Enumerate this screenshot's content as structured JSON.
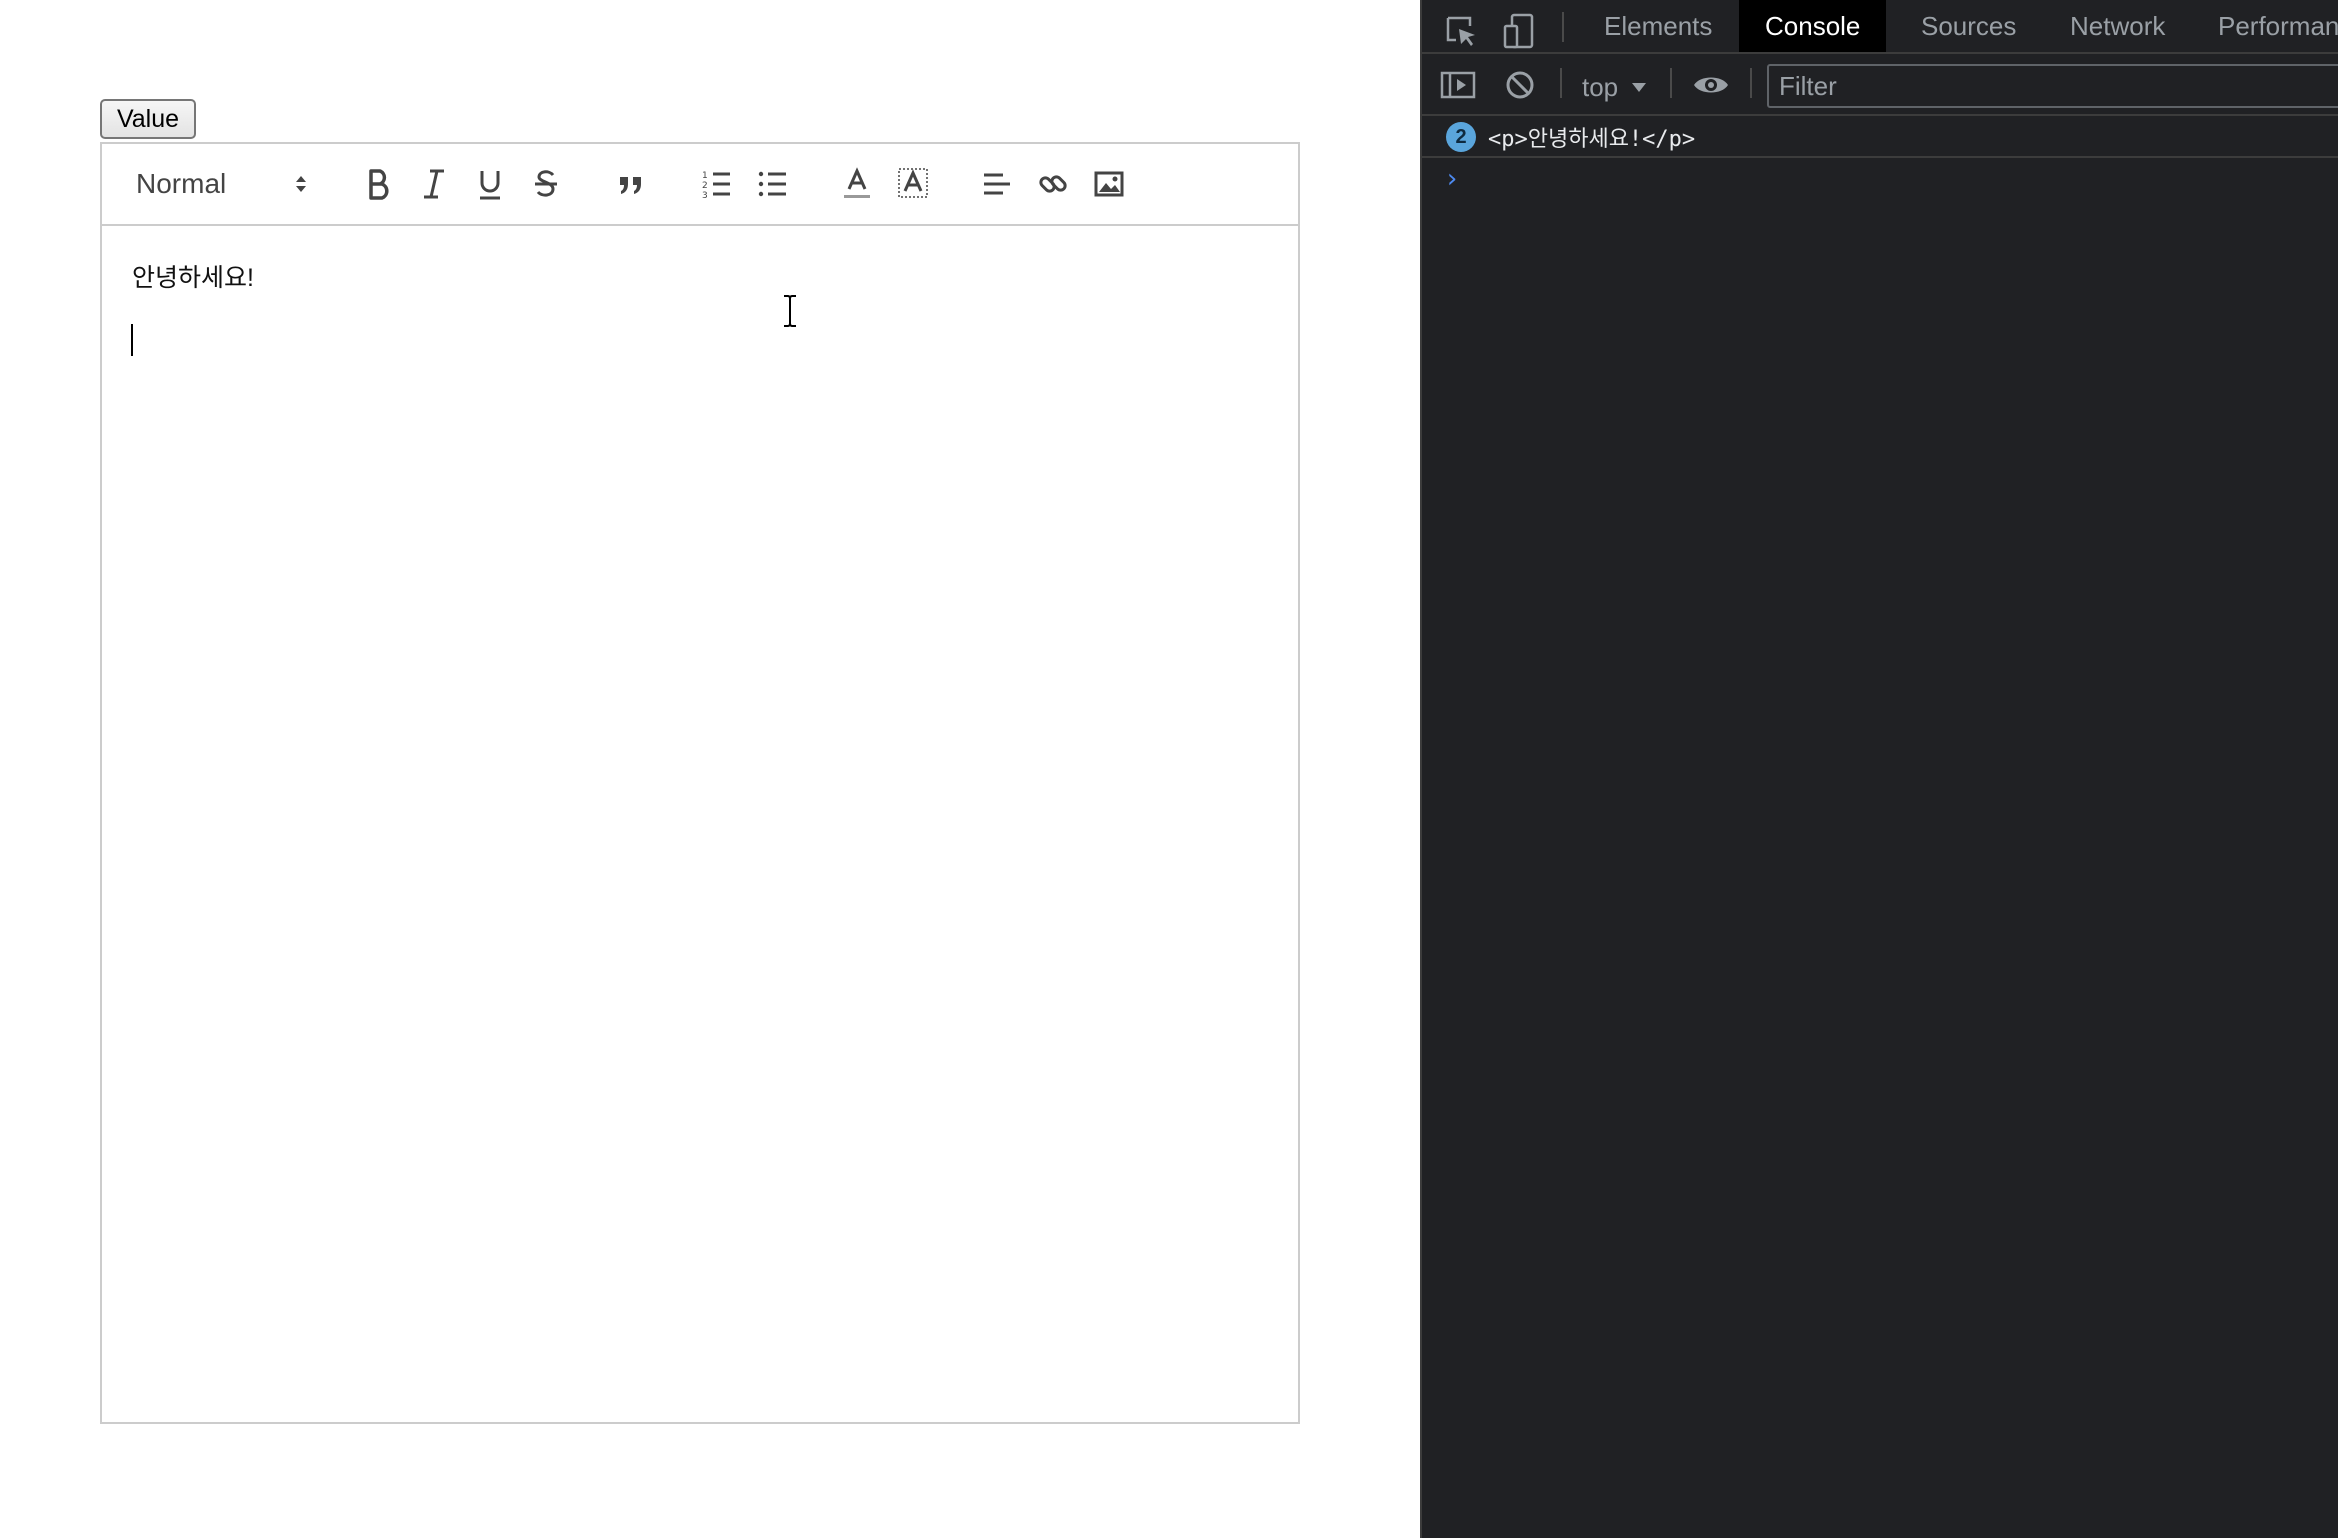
{
  "page": {
    "value_button_label": "Value"
  },
  "editor": {
    "toolbar": {
      "header_select": "Normal",
      "buttons": [
        "bold",
        "italic",
        "underline",
        "strike",
        "blockquote",
        "ordered-list",
        "bullet-list",
        "text-color",
        "background-color",
        "align",
        "link",
        "image"
      ]
    },
    "lines": [
      "안녕하세요!",
      ""
    ]
  },
  "devtools": {
    "tabs": [
      "Elements",
      "Console",
      "Sources",
      "Network",
      "Performanc"
    ],
    "active_tab": "Console",
    "context": "top",
    "filter_placeholder": "Filter",
    "log": {
      "count": "2",
      "message": "<p>안녕하세요!</p>"
    },
    "prompt_symbol": "›"
  },
  "colors": {
    "devtools_bg": "#202124",
    "badge": "#5aa5dc",
    "prompt": "#4d8af0",
    "editor_border": "#cccccc"
  }
}
